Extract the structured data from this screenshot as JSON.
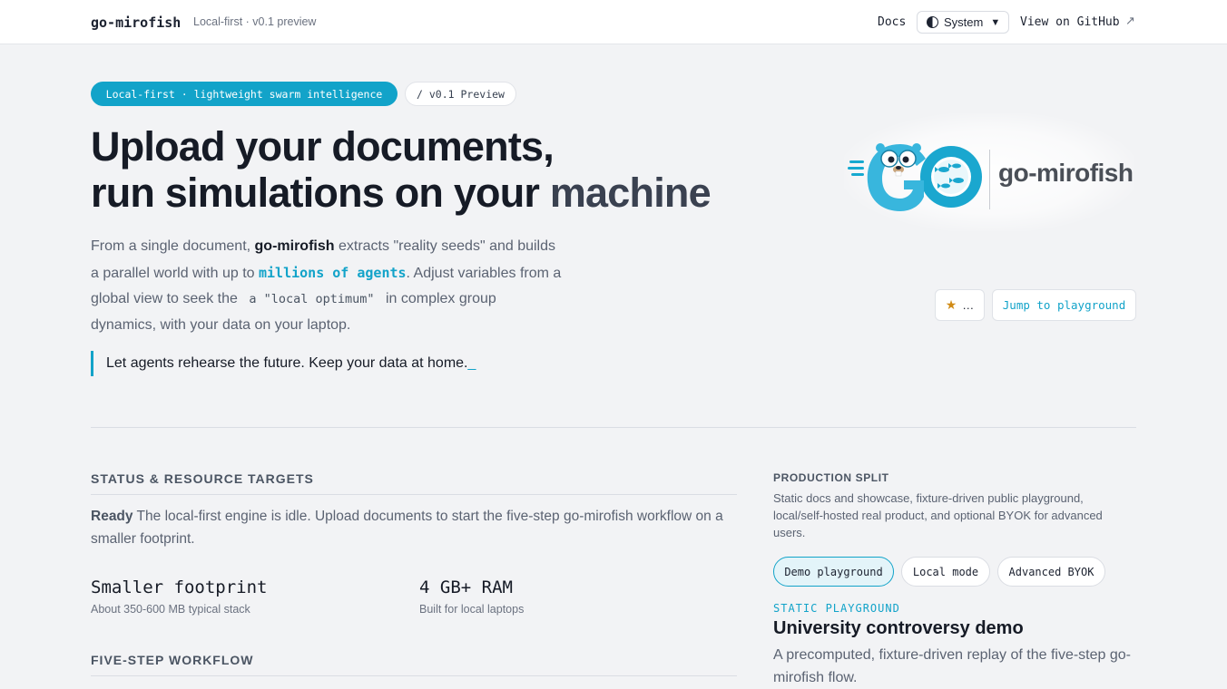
{
  "header": {
    "brand": "go-mirofish",
    "subtitle": "Local-first · v0.1 preview",
    "docs_label": "Docs",
    "theme_label": "System",
    "theme_caret": "▼",
    "github_label": "View on GitHub",
    "github_arrow": "↗"
  },
  "hero": {
    "badge_primary": "Local-first · lightweight swarm intelligence",
    "badge_version": "/ v0.1 Preview",
    "title_line1": "Upload your documents,",
    "title_line2a": "run simulations on your ",
    "title_line2b": "machine",
    "desc": {
      "p1": "From a single document, ",
      "brand": "go-mirofish",
      "p2": " extracts \"reality seeds\" and builds a parallel world with up to ",
      "highlight": "millions of agents",
      "p3": ". Adjust variables from a global view to seek the ",
      "code": "a \"local optimum\"",
      "p4": " in complex group dynamics, with your data on your laptop."
    },
    "tagline": "Let agents rehearse the future. Keep your data at home.",
    "cursor": "_",
    "logo_text": "go-mirofish",
    "star_icon": "★",
    "star_count": "…",
    "playground_button": "Jump to playground"
  },
  "status": {
    "heading": "STATUS & RESOURCE TARGETS",
    "state": "Ready",
    "message": " The local-first engine is idle. Upload documents to start the five-step go-mirofish workflow on a smaller footprint.",
    "metrics": [
      {
        "value": "Smaller footprint",
        "caption": "About 350-600 MB typical stack"
      },
      {
        "value": "4 GB+ RAM",
        "caption": "Built for local laptops"
      }
    ]
  },
  "workflow": {
    "heading": "FIVE-STEP WORKFLOW"
  },
  "production": {
    "heading": "PRODUCTION SPLIT",
    "description": "Static docs and showcase, fixture-driven public playground, local/self-hosted real product, and optional BYOK for advanced users.",
    "modes": [
      "Demo playground",
      "Local mode",
      "Advanced BYOK"
    ],
    "active_mode": "Demo playground",
    "section_label": "STATIC PLAYGROUND",
    "title": "University controversy demo",
    "summary": "A precomputed, fixture-driven replay of the five-step go-mirofish flow."
  },
  "colors": {
    "accent": "#12a3c9",
    "background": "#f2f3f5",
    "text": "#161b26"
  }
}
